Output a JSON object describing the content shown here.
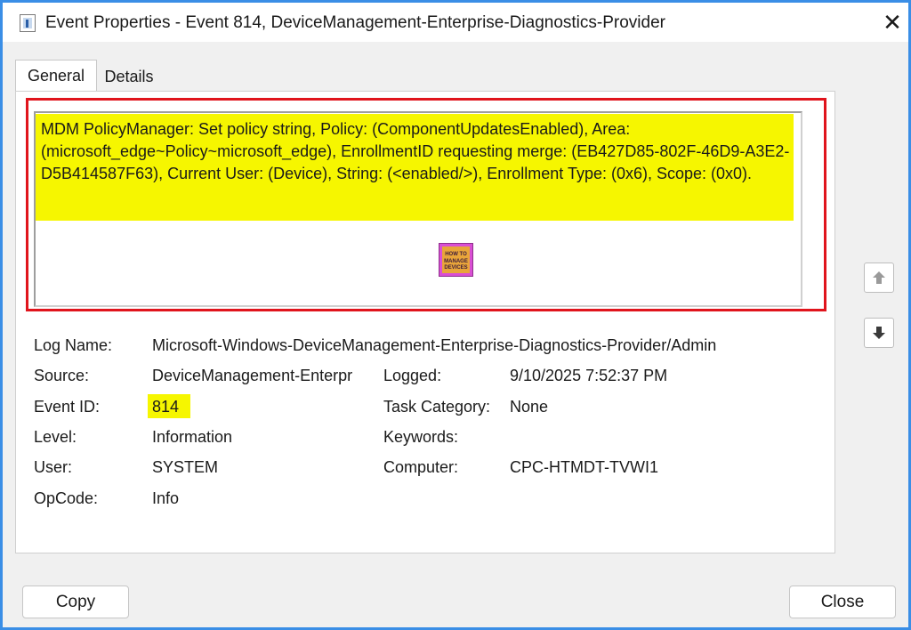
{
  "window": {
    "title": "Event Properties - Event 814, DeviceManagement-Enterprise-Diagnostics-Provider"
  },
  "tabs": [
    {
      "label": "General",
      "selected": true
    },
    {
      "label": "Details",
      "selected": false
    }
  ],
  "description": "MDM PolicyManager: Set policy string, Policy: (ComponentUpdatesEnabled), Area: (microsoft_edge~Policy~microsoft_edge), EnrollmentID requesting merge: (EB427D85-802F-46D9-A3E2-D5B414587F63), Current User: (Device), String: (<enabled/>), Enrollment Type: (0x6), Scope: (0x0).",
  "logo": {
    "line1": "HOW TO",
    "line2": "MANAGE",
    "line3": "DEVICES"
  },
  "fields": {
    "log_name": {
      "label": "Log Name:",
      "value": "Microsoft-Windows-DeviceManagement-Enterprise-Diagnostics-Provider/Admin"
    },
    "source": {
      "label": "Source:",
      "value": "DeviceManagement-Enterpr"
    },
    "logged": {
      "label": "Logged:",
      "value": "9/10/2025 7:52:37 PM"
    },
    "event_id": {
      "label": "Event ID:",
      "value": "814"
    },
    "task_category": {
      "label": "Task Category:",
      "value": "None"
    },
    "level": {
      "label": "Level:",
      "value": "Information"
    },
    "keywords": {
      "label": "Keywords:",
      "value": ""
    },
    "user": {
      "label": "User:",
      "value": "SYSTEM"
    },
    "computer": {
      "label": "Computer:",
      "value": "CPC-HTMDT-TVWI1"
    },
    "opcode": {
      "label": "OpCode:",
      "value": "Info"
    }
  },
  "buttons": {
    "copy": "Copy",
    "close": "Close"
  },
  "icons": {
    "app": "event-viewer-icon",
    "close": "close-icon",
    "up": "arrow-up-icon",
    "down": "arrow-down-icon"
  },
  "colors": {
    "highlight": "#f6f600",
    "annotation_frame": "#e0141c",
    "accent_border": "#3a8ee6"
  }
}
